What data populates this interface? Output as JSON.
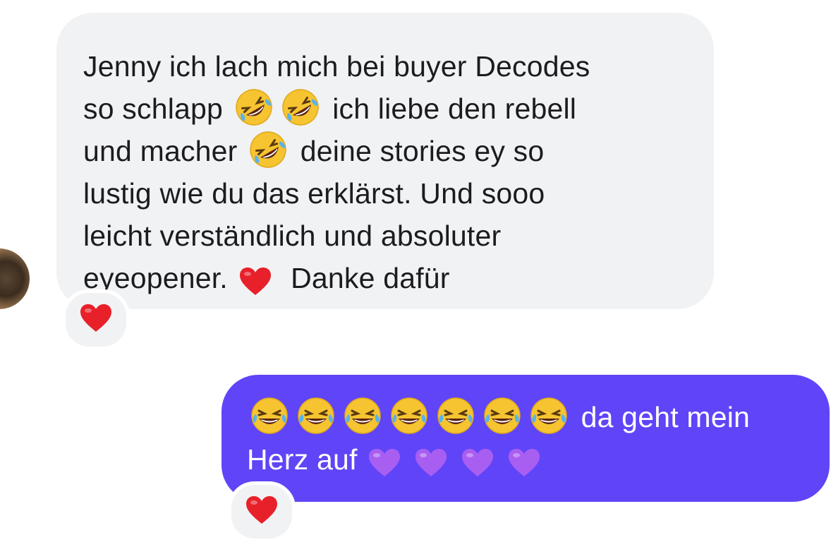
{
  "incoming_message": {
    "lines": [
      {
        "segments": [
          {
            "type": "text",
            "value": "Jenny ich lach mich bei buyer Decodes"
          }
        ]
      },
      {
        "segments": [
          {
            "type": "text",
            "value": "so schlapp "
          },
          {
            "type": "emoji",
            "value": "rolling-on-floor-laughing"
          },
          {
            "type": "emoji",
            "value": "rolling-on-floor-laughing"
          },
          {
            "type": "text",
            "value": " ich liebe den rebell"
          }
        ]
      },
      {
        "segments": [
          {
            "type": "text",
            "value": "und macher "
          },
          {
            "type": "emoji",
            "value": "rolling-on-floor-laughing"
          },
          {
            "type": "text",
            "value": " deine stories ey so"
          }
        ]
      },
      {
        "segments": [
          {
            "type": "text",
            "value": "lustig wie du das erklärst. Und sooo"
          }
        ]
      },
      {
        "segments": [
          {
            "type": "text",
            "value": "leicht verständlich und absoluter"
          }
        ]
      },
      {
        "segments": [
          {
            "type": "text",
            "value": "eyeopener. "
          },
          {
            "type": "emoji",
            "value": "red-heart"
          },
          {
            "type": "text",
            "value": " Danke dafür"
          }
        ]
      }
    ],
    "reaction": "red-heart"
  },
  "outgoing_message": {
    "lines": [
      {
        "segments": [
          {
            "type": "emoji",
            "value": "face-with-tears-of-joy"
          },
          {
            "type": "emoji",
            "value": "face-with-tears-of-joy"
          },
          {
            "type": "emoji",
            "value": "face-with-tears-of-joy"
          },
          {
            "type": "emoji",
            "value": "face-with-tears-of-joy"
          },
          {
            "type": "emoji",
            "value": "face-with-tears-of-joy"
          },
          {
            "type": "emoji",
            "value": "face-with-tears-of-joy"
          },
          {
            "type": "emoji",
            "value": "face-with-tears-of-joy"
          },
          {
            "type": "text",
            "value": " da geht mein"
          }
        ]
      },
      {
        "segments": [
          {
            "type": "text",
            "value": "Herz auf "
          },
          {
            "type": "emoji",
            "value": "purple-heart"
          },
          {
            "type": "emoji",
            "value": "purple-heart"
          },
          {
            "type": "emoji",
            "value": "purple-heart"
          },
          {
            "type": "emoji",
            "value": "purple-heart"
          }
        ]
      }
    ],
    "reaction": "red-heart"
  },
  "colors": {
    "incoming_bubble": "#f1f2f4",
    "outgoing_bubble": "#5f45f7",
    "incoming_text": "#1c1c1e",
    "outgoing_text": "#ffffff",
    "red_heart": "#e8202a",
    "purple_heart": "#a95ef2"
  }
}
